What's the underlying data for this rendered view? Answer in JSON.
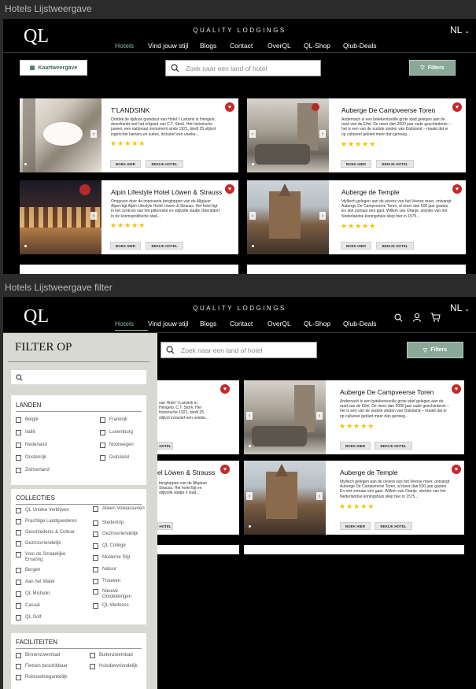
{
  "frames": [
    {
      "label": "Hotels Lijstweergave",
      "brand_tagline": "QUALITY LODGINGS",
      "logo": "QL",
      "lang": "NL",
      "menu": [
        "Hotels",
        "Vind jouw stijl",
        "Blogs",
        "Contact",
        "OverQL",
        "QL-Shop",
        "Qlub-Deals"
      ],
      "map_button": "Kaartweergave",
      "search_placeholder": "Zoek naar een land of hotel",
      "filter_button": "Filters",
      "cards": [
        {
          "name": "T'LANDSINK",
          "desc": "Ontdek de tijdloze grandeur van Hotel 't Lansink in Hengelo, doordrenkt met het erfgoed van C.T. Stork. Het historische juweel, een nationaal monument sinds 1921, biedt 25 stijlvol ingerichte kamers en suites, inclusief een unieke...",
          "stars": "★★★★★",
          "book": "BOEK HIER",
          "view": "BEKIJK HOTEL"
        },
        {
          "name": "Auberge De Campveerse Toren",
          "desc": "Andernach is een betekenisvolle grote stad gelegen aan de rand van de Eifel. De meer dan 2000 jaar oude geschiedenis – het is een van de oudste steden van Duitsland – maakt dat er op cultureel gebied meer dan genoeg...",
          "stars": "★★★★★",
          "book": "BOEK HIER",
          "view": "BEKIJK HOTEL"
        },
        {
          "name": "Alpin Lifestyle Hotel Löwen & Strauss",
          "desc": "Omgeven door de imposante bergtoppen van de Allgäuer Alpen ligt Alpin Lifestyle Hotel Löwen & Strauss. Het hotel ligt in het centrum van het pittoreske en stijlvolle stadje Oberstdorf. In de kosmopolitische stad...",
          "stars": "★★★★★",
          "book": "BOEK HIER",
          "view": "BEKIJK HOTEL"
        },
        {
          "name": "Auberge de Temple",
          "desc": "Idyllisch gelegen aan de oevers van het Veerse meer, ontvangt Auberge De Campveerse Toren, al meer dan 500 jaar gasten. En niet zomaar een gast. Willem van Oranje, stichter van het Nederlandse koningshuis sliep hier in 1575...",
          "stars": "★★★★★",
          "book": "BOEK HIER",
          "view": "BEKIJK HOTEL"
        }
      ]
    },
    {
      "label": "Hotels Lijstweergave filter",
      "brand_tagline": "QUALITY LODGINGS",
      "logo": "QL",
      "lang": "NL",
      "menu": [
        "Hotels",
        "Vind jouw stijl",
        "Blogs",
        "Contact",
        "OverQL",
        "QL-Shop",
        "Qlub-Deals"
      ],
      "search_placeholder": "Zoek naar een land of hotel",
      "filter_button": "Filters",
      "cards": [
        {
          "name": "",
          "desc": "van Hotel 't Lansink in Hengelo, C.T. Stork. Het historische 1921, biedt 25 stijlvol inclusief een unieke...",
          "stars": "",
          "book": "HOTEL",
          "view": ""
        },
        {
          "name": "Auberge De Campveerse Toren",
          "desc": "Andernach is een betekenisvolle grote stad gelegen aan de rand van de Eifel. De meer dan 2000 jaar oude geschiedenis – het is een van de oudste steden van Duitsland – maakt dat er op cultureel gebied meer dan genoeg...",
          "stars": "★★★★★",
          "book": "BOEK HIER",
          "view": "BEKIJK HOTEL"
        },
        {
          "name": "el Löwen & Strauss",
          "desc": "bergtoppen van de Allgäuer Strauss. Het hotel ligt en stijlvolle stadje n stad...",
          "stars": "",
          "book": "HOTEL",
          "view": ""
        },
        {
          "name": "Auberge de Temple",
          "desc": "Idyllisch gelegen aan de oevers van het Veerse meer, ontvangt Auberge De Campveerse Toren, al meer dan 500 jaar gasten. En niet zomaar een gast. Willem van Oranje, stichter van het Nederlandse koningshuis sliep hier in 1575...",
          "stars": "★★★★★",
          "book": "BOEK HIER",
          "view": "BEKIJK HOTEL"
        }
      ],
      "filter_panel": {
        "title": "FILTER OP",
        "landen_title": "LANDEN",
        "landen": [
          "België",
          "Frankrijk",
          "Italië",
          "Luxemburg",
          "Nederland",
          "Noorwegen",
          "Oostenrijk",
          "Duitsland",
          "Zwitserland"
        ],
        "collecties_title": "COLLECTIES",
        "collecties_left": [
          "QL Unieke Verblijven",
          "Prachtige Landgoederen",
          "Geschiedenis & Cultuur",
          "Gezinsvriendelijk",
          "Voor de Smakelijke Ervaring",
          "Bergen",
          "Aan het Water",
          "QL Michelin",
          "Casual",
          "QL Golf"
        ],
        "collecties_right": [
          "Alleen Volwassenen",
          "Stedentrip",
          "Gezinsvriendelijk",
          "QL College",
          "Moderne Stijl",
          "Natuur",
          "Trouwen",
          "Nieuwe Ontdekkingen",
          "QL Wellness"
        ],
        "faciliteiten_title": "FACILITEITEN",
        "faciliteiten": [
          "Binnenzwembad",
          "Buitenzwembad",
          "Fietsen beschikbaar",
          "Huisdiervriendelijk",
          "Rolstoeltoegankelijk"
        ]
      }
    }
  ],
  "colors": {
    "accent": "#8db59f",
    "filter_button": "#8aa898",
    "heart": "#c42a2a",
    "stars": "#f2c200",
    "panel": "#d9d9d4"
  }
}
